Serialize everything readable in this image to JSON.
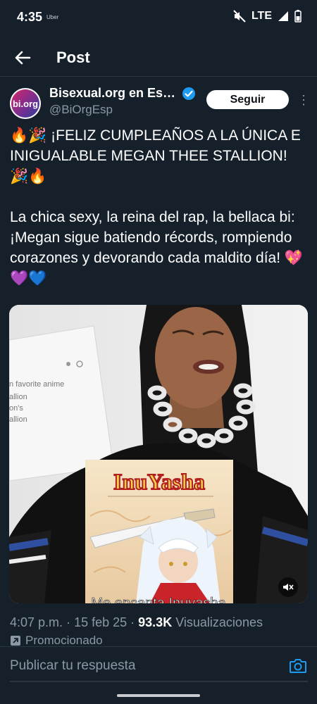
{
  "status_bar": {
    "time": "4:35",
    "carrier_small": "Uber",
    "network": "LTE"
  },
  "header": {
    "title": "Post"
  },
  "post": {
    "author_name": "Bisexual.org en Es…",
    "author_handle": "@BiOrgEsp",
    "avatar_text": "bi.org",
    "follow_label": "Seguir",
    "text_paragraph_1": "🔥🎉 ¡FELIZ CUMPLEAÑOS A LA ÚNICA E INIGUALABLE MEGAN THEE STALLION! 🎉🔥",
    "text_paragraph_2": "La chica sexy, la reina del rap, la bellaca bi: ¡Megan sigue batiendo récords, rompiendo corazones y devorando cada maldito día! 💖💜💙",
    "media": {
      "paper_lines": [
        "n favorite anime",
        "allion",
        "on's",
        "allion"
      ],
      "poster_title": "InuYasha",
      "caption": "Me encanta Inuyasha"
    },
    "time": "4:07 p.m.",
    "date": "15 feb 25",
    "views_count": "93.3K",
    "views_label": "Visualizaciones",
    "promoted_label": "Promocionado"
  },
  "reply": {
    "placeholder": "Publicar tu respuesta"
  },
  "colors": {
    "background": "#15202b",
    "accent": "#1d9bf0",
    "muted": "#8b98a5"
  }
}
